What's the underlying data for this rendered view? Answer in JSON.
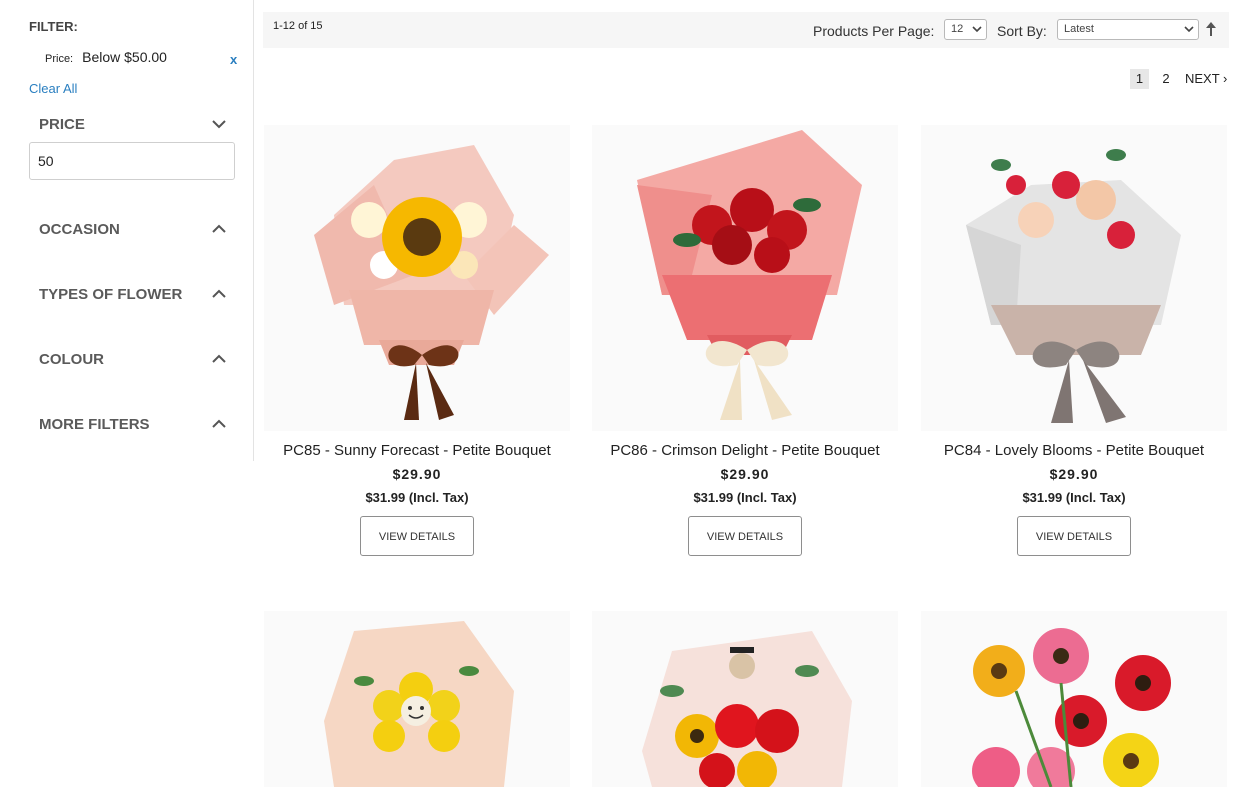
{
  "sidebar": {
    "filter_title": "FILTER:",
    "active_filter": {
      "key": "Price:",
      "value": "Below $50.00",
      "remove": "x"
    },
    "clear_all": "Clear All",
    "price_label": "PRICE",
    "price_value": "50",
    "facets": [
      "OCCASION",
      "TYPES OF FLOWER",
      "COLOUR",
      "MORE FILTERS"
    ]
  },
  "toolbar": {
    "count": "1-12 of 15",
    "per_page_label": "Products Per Page:",
    "per_page_value": "12",
    "sort_label": "Sort By:",
    "sort_value": "Latest"
  },
  "pagination": {
    "current": "1",
    "page2": "2",
    "next": "NEXT ›"
  },
  "products": [
    {
      "name": "PC85 - Sunny Forecast - Petite Bouquet",
      "price": "$29.90",
      "price_tax": "$31.99 (Incl. Tax)",
      "button": "VIEW DETAILS"
    },
    {
      "name": "PC86 - Crimson Delight - Petite Bouquet",
      "price": "$29.90",
      "price_tax": "$31.99 (Incl. Tax)",
      "button": "VIEW DETAILS"
    },
    {
      "name": "PC84 - Lovely Blooms - Petite Bouquet",
      "price": "$29.90",
      "price_tax": "$31.99 (Incl. Tax)",
      "button": "VIEW DETAILS"
    }
  ],
  "colors": {
    "link": "#2a7fc0",
    "toolbar_bg": "#f6f6f6",
    "divider": "#e3e3e3"
  },
  "icons": [
    "chevron-down-icon",
    "chevron-up-icon",
    "close-icon",
    "sort-direction-icon",
    "dropdown-arrow-icon"
  ]
}
